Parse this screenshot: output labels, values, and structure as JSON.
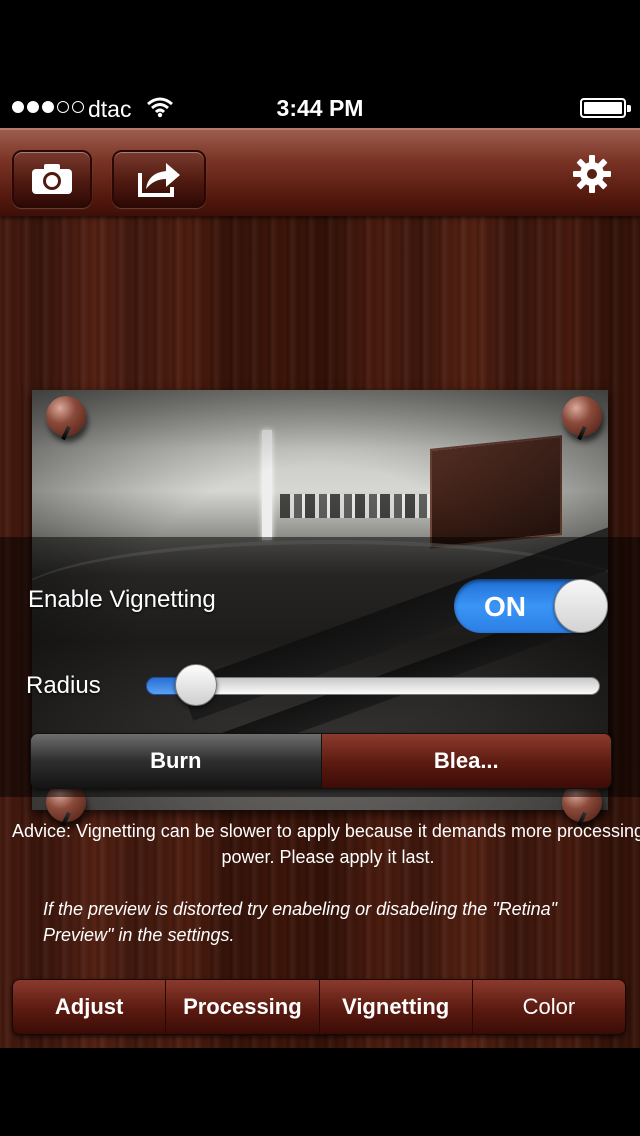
{
  "status_bar": {
    "carrier": "dtac",
    "time": "3:44 PM",
    "signal_bars_filled": 3,
    "signal_bars_total": 5
  },
  "toolbar": {
    "camera_icon": "camera-icon",
    "share_icon": "share-icon",
    "settings_icon": "gear-icon"
  },
  "vignette": {
    "enable_label": "Enable Vignetting",
    "toggle_label": "ON",
    "toggle_on": true,
    "radius_label": "Radius",
    "radius_value": 0.05,
    "modes": [
      "Burn",
      "Blea..."
    ],
    "selected_mode": "Burn"
  },
  "advice": "Advice: Vignetting can be slower to apply because it demands more processing power. Please apply it last.",
  "tip": "If the preview is distorted try enabeling or disabeling the \"Retina\" Preview\" in the settings.",
  "tabs": [
    "Adjust",
    "Processing",
    "Vignetting",
    "Color"
  ],
  "colors": {
    "accent_blue": "#2b7fe6",
    "wood_dark": "#3e1509",
    "toolbar": "#7a3426"
  }
}
